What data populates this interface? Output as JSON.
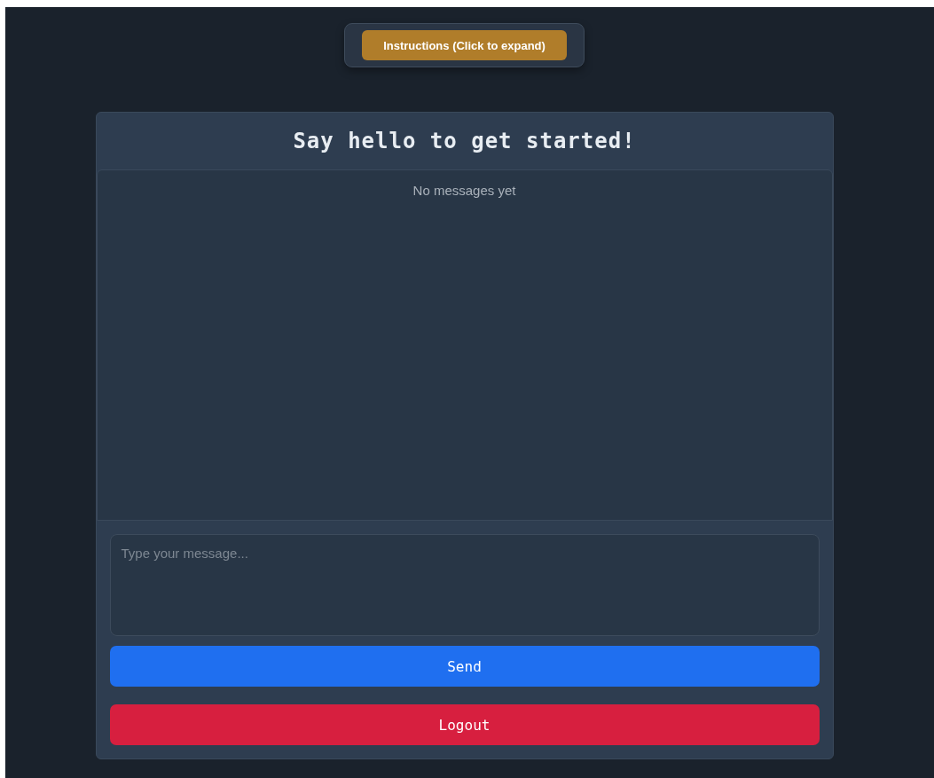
{
  "instructions": {
    "label": "Instructions (Click to expand)",
    "expanded": false
  },
  "chat": {
    "title": "Say hello to get started!",
    "empty_text": "No messages yet"
  },
  "composer": {
    "placeholder": "Type your message..."
  },
  "buttons": [
    {
      "label": "Send",
      "kind": "primary"
    },
    {
      "label": "Logout",
      "kind": "danger"
    }
  ]
}
